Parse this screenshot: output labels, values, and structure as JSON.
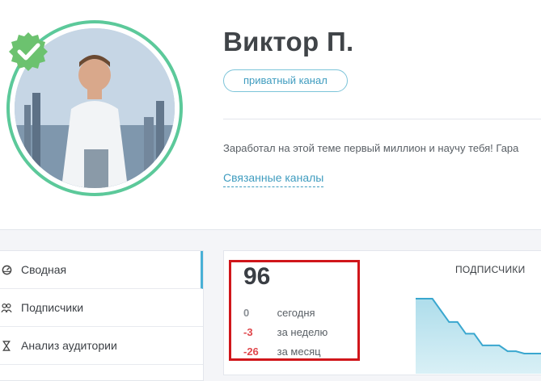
{
  "profile": {
    "name": "Виктор П.",
    "channel_type": "приватный канал",
    "bio": "Заработал на этой теме первый миллион и научу тебя! Гара",
    "related_link": "Связанные каналы"
  },
  "sidebar": {
    "items": [
      {
        "label": "Сводная",
        "icon": "dashboard-icon"
      },
      {
        "label": "Подписчики",
        "icon": "users-icon"
      },
      {
        "label": "Анализ аудитории",
        "icon": "hourglass-icon"
      }
    ]
  },
  "stats": {
    "total": "96",
    "rows": [
      {
        "value": "0",
        "label": "сегодня",
        "color": "#8a8f95"
      },
      {
        "value": "-3",
        "label": "за неделю",
        "color": "#e0474c"
      },
      {
        "value": "-26",
        "label": "за месяц",
        "color": "#e0474c"
      }
    ]
  },
  "chart_data": {
    "type": "area",
    "title": "ПОДПИСЧИКИ",
    "values": [
      100,
      100,
      100,
      99,
      98,
      98,
      97,
      97,
      96,
      96,
      96,
      95.5,
      95.5,
      95.3,
      95.3,
      95.3
    ]
  },
  "colors": {
    "accent": "#3f9cbf",
    "verified": "#5cc99a",
    "highlight": "#d0161b",
    "negative": "#e0474c"
  }
}
